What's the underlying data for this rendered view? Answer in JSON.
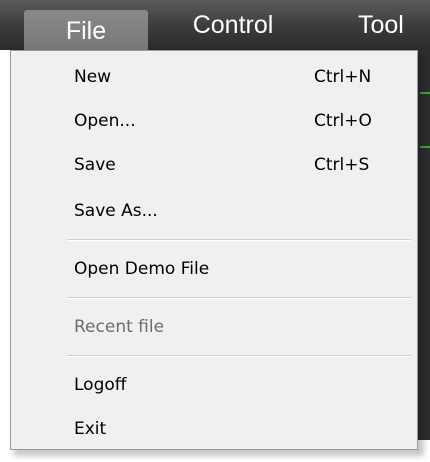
{
  "menubar": {
    "file_label": "File",
    "control_label": "Control",
    "tool_label": "Tool"
  },
  "file_menu": {
    "items": [
      {
        "label": "New",
        "shortcut": "Ctrl+N",
        "enabled": true
      },
      {
        "label": "Open...",
        "shortcut": "Ctrl+O",
        "enabled": true
      },
      {
        "label": "Save",
        "shortcut": "Ctrl+S",
        "enabled": true
      },
      {
        "label": "Save As...",
        "shortcut": "",
        "enabled": true
      },
      {
        "label": "Open Demo File",
        "shortcut": "",
        "enabled": true
      },
      {
        "label": "Recent file",
        "shortcut": "",
        "enabled": false
      },
      {
        "label": "Logoff",
        "shortcut": "",
        "enabled": true
      },
      {
        "label": "Exit",
        "shortcut": "",
        "enabled": true
      }
    ]
  },
  "colors": {
    "menubar_bg": "#3b3b3b",
    "menubar_active": "#7f7f7f",
    "menu_bg": "#f0f0f0",
    "disabled_text": "#6d6d6d",
    "accent_green": "#3ca63c"
  }
}
